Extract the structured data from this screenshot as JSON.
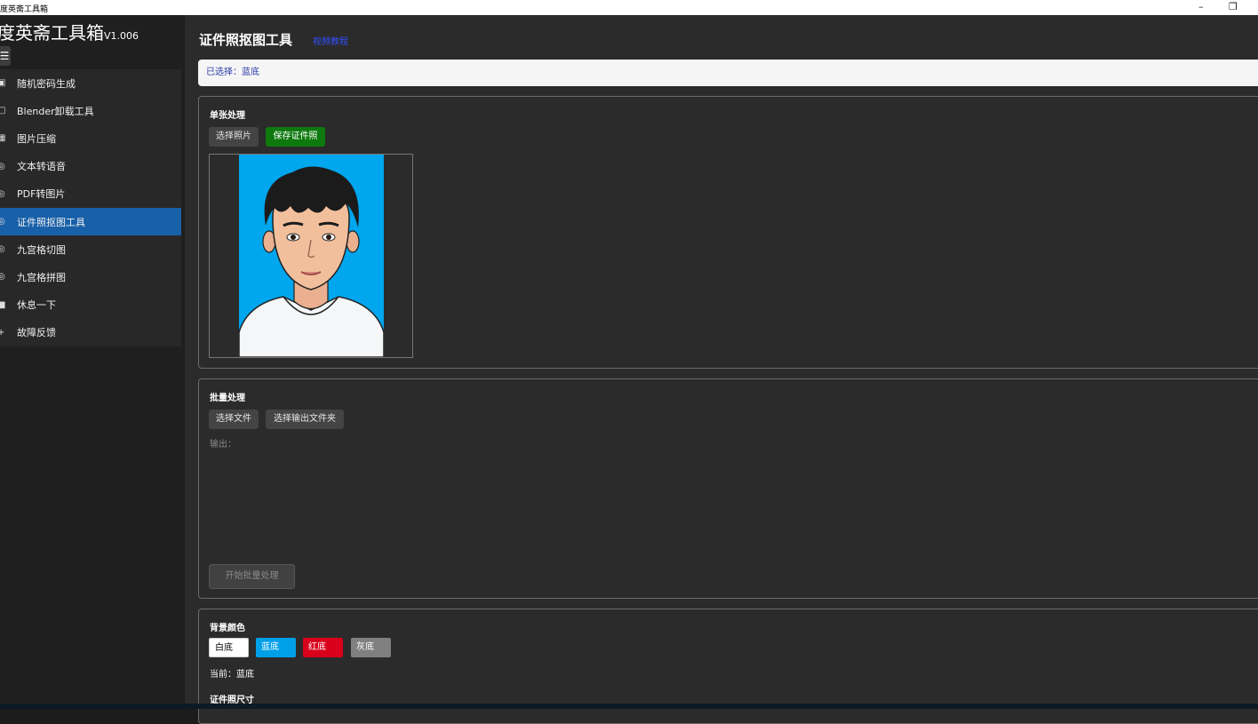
{
  "window": {
    "title": "度英斋工具箱",
    "minimize_icon": "minimize-icon",
    "restore_icon": "restore-icon"
  },
  "sidebar": {
    "app_name": "度英斋工具箱",
    "version": "V1.006",
    "menu_icon": "hamburger-icon",
    "items": [
      {
        "label": "随机密码生成",
        "icon": "password-icon"
      },
      {
        "label": "Blender卸载工具",
        "icon": "uninstall-icon"
      },
      {
        "label": "图片压缩",
        "icon": "compress-icon"
      },
      {
        "label": "文本转语音",
        "icon": "tts-icon"
      },
      {
        "label": "PDF转图片",
        "icon": "pdf-icon"
      },
      {
        "label": "证件照抠图工具",
        "icon": "idphoto-icon",
        "active": true
      },
      {
        "label": "九宫格切图",
        "icon": "grid-cut-icon"
      },
      {
        "label": "九宫格拼图",
        "icon": "grid-join-icon"
      },
      {
        "label": "休息一下",
        "icon": "rest-icon"
      },
      {
        "label": "故障反馈",
        "icon": "feedback-icon"
      }
    ]
  },
  "main": {
    "title": "证件照抠图工具",
    "link": "视频教程",
    "selected": "已选择：蓝底",
    "single": {
      "title": "单张处理",
      "choose_photo": "选择照片",
      "save_photo": "保存证件照"
    },
    "batch": {
      "title": "批量处理",
      "choose_files": "选择文件",
      "choose_output": "选择输出文件夹",
      "output_label": "输出：",
      "start": "开始批量处理"
    },
    "background": {
      "title": "背景颜色",
      "options": [
        {
          "label": "白底",
          "color": "#ffffff",
          "text_color": "#000000"
        },
        {
          "label": "蓝底",
          "color": "#00a0e9",
          "text_color": "#ffffff"
        },
        {
          "label": "红底",
          "color": "#d9001b",
          "text_color": "#ffffff"
        },
        {
          "label": "灰底",
          "color": "#808080",
          "text_color": "#ffffff"
        }
      ],
      "current": "当前：蓝底"
    },
    "size": {
      "title": "证件照尺寸"
    }
  }
}
